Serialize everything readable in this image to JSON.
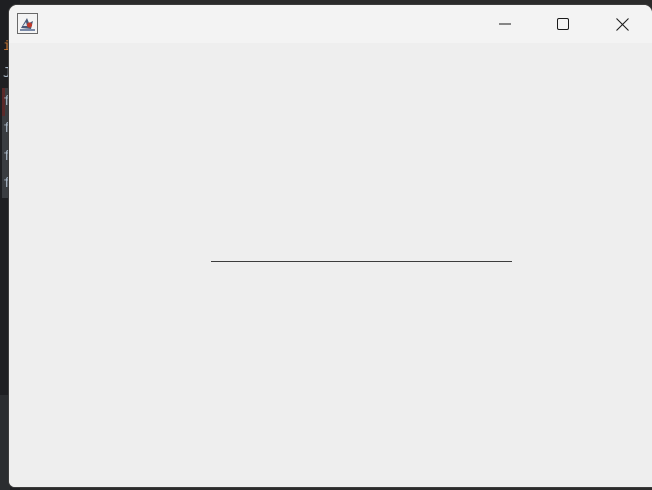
{
  "background_editor": {
    "gutter_glyphs": [
      "i",
      "J",
      "f",
      "f",
      "f",
      "f"
    ]
  },
  "window": {
    "title": "",
    "icon": "java-duke-icon",
    "controls": {
      "minimize": "minimize-icon",
      "maximize": "maximize-icon",
      "close": "close-icon"
    }
  },
  "content": {
    "text_field": {
      "value": "",
      "placeholder": ""
    }
  },
  "colors": {
    "window_bg": "#eeeeee",
    "titlebar_bg": "#f3f3f3",
    "field_underline": "#3c3c3c",
    "desktop_bg": "#1e1f22"
  }
}
